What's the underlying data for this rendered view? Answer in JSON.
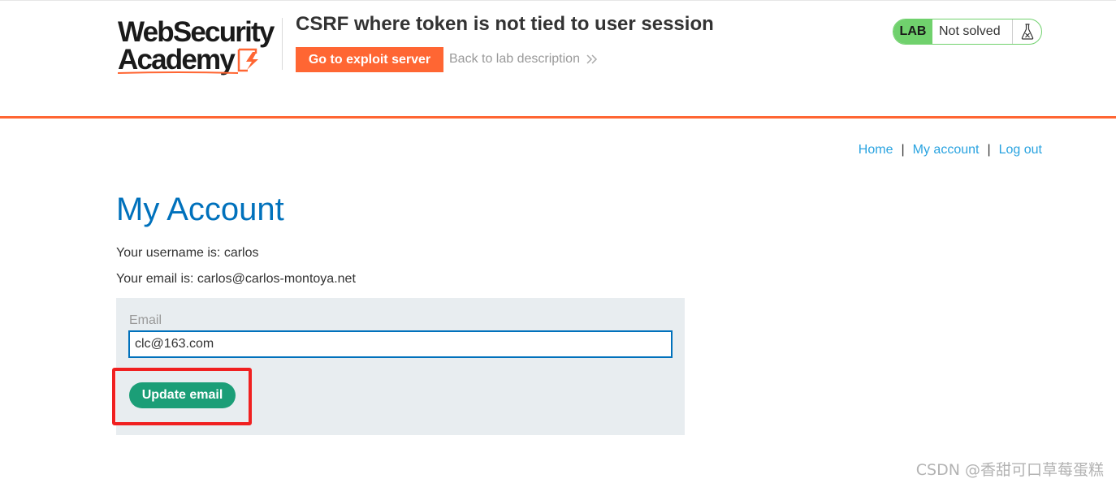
{
  "header": {
    "logo_line1": "WebSecurity",
    "logo_line2": "Academy",
    "lab_title": "CSRF where token is not tied to user session",
    "exploit_button": "Go to exploit server",
    "back_link": "Back to lab description",
    "lab_badge": "LAB",
    "lab_status": "Not solved",
    "accent_color": "#ff6633",
    "status_color": "#70d16d"
  },
  "nav": {
    "home": "Home",
    "separator": "|",
    "my_account": "My account",
    "log_out": "Log out"
  },
  "main": {
    "title": "My Account",
    "username_line": "Your username is: carlos",
    "email_line": "Your email is: carlos@carlos-montoya.net",
    "form": {
      "email_label": "Email",
      "email_value": "clc@163.com",
      "update_button": "Update email"
    }
  },
  "watermark": "CSDN @香甜可口草莓蛋糕",
  "icons": {
    "lab_flask": "flask-icon",
    "back_chevron": "double-chevron-right-icon",
    "logo_bolt": "lightning-bolt-icon"
  }
}
